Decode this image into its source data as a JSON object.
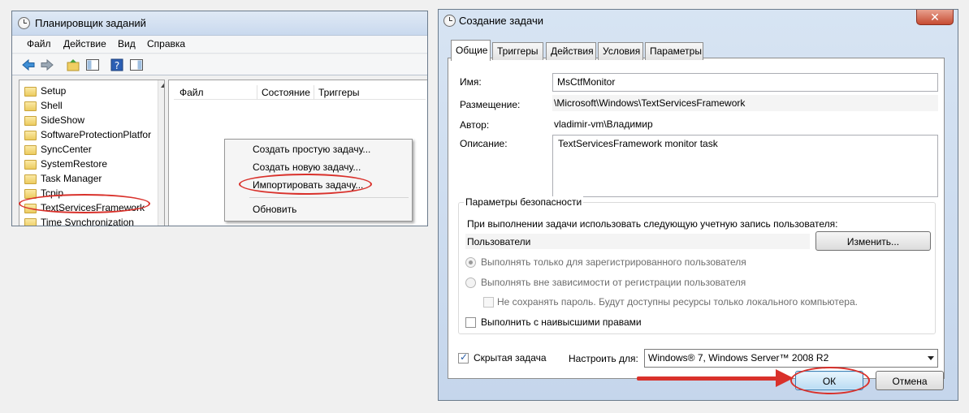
{
  "scheduler": {
    "title": "Планировщик заданий",
    "menu": [
      "Файл",
      "Действие",
      "Вид",
      "Справка"
    ],
    "tree_items": [
      "Setup",
      "Shell",
      "SideShow",
      "SoftwareProtectionPlatfor",
      "SyncCenter",
      "SystemRestore",
      "Task Manager",
      "Tcpip",
      "TextServicesFramework",
      "Time Synchronization"
    ],
    "columns": [
      "Файл",
      "Состояние",
      "Триггеры"
    ],
    "context_menu": [
      "Создать простую задачу...",
      "Создать новую задачу...",
      "Импортировать задачу...",
      "Обновить"
    ]
  },
  "create_task": {
    "title": "Создание задачи",
    "tabs": [
      "Общие",
      "Триггеры",
      "Действия",
      "Условия",
      "Параметры"
    ],
    "name_label": "Имя:",
    "name_value": "MsCtfMonitor",
    "location_label": "Размещение:",
    "location_value": "\\Microsoft\\Windows\\TextServicesFramework",
    "author_label": "Автор:",
    "author_value": "vladimir-vm\\Владимир",
    "description_label": "Описание:",
    "description_value": "TextServicesFramework monitor task",
    "security": {
      "title": "Параметры безопасности",
      "account_prompt": "При выполнении задачи использовать следующую учетную запись пользователя:",
      "account_value": "Пользователи",
      "change_button": "Изменить...",
      "radio_logged_on": "Выполнять только для зарегистрированного пользователя",
      "radio_any": "Выполнять вне зависимости от регистрации пользователя",
      "dont_store_password": "Не сохранять пароль. Будут доступны ресурсы только локального компьютера.",
      "highest_privileges": "Выполнить с наивысшими правами"
    },
    "hidden_label": "Скрытая задача",
    "configure_label": "Настроить для:",
    "configure_value": "Windows® 7, Windows Server™ 2008 R2",
    "ok_button": "ОК",
    "cancel_button": "Отмена"
  }
}
